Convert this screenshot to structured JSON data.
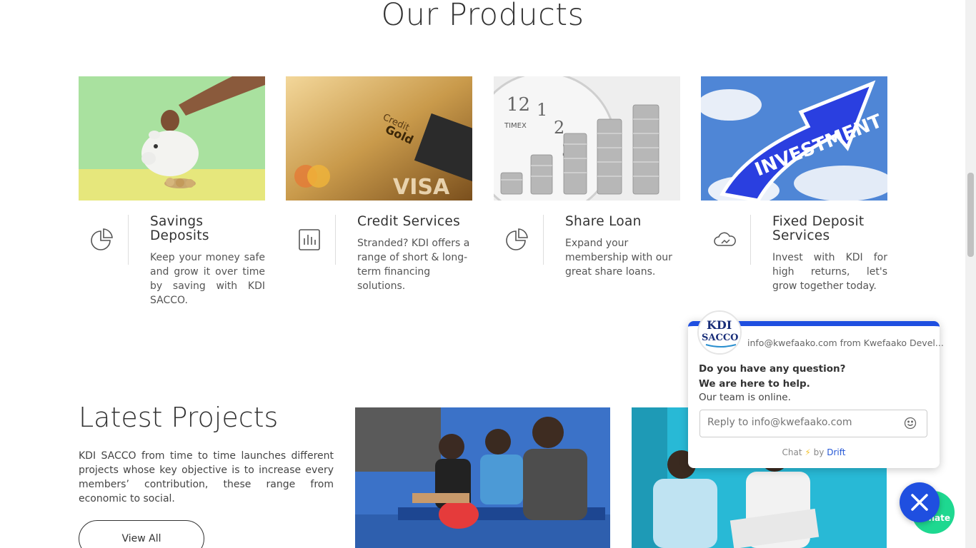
{
  "products": {
    "heading": "Our Products",
    "cards": [
      {
        "title": "Savings Deposits",
        "icon": "pie-chart-icon",
        "description": "Keep your money safe and grow it over time by saving with KDI SACCO."
      },
      {
        "title": "Credit Services",
        "icon": "bar-chart-icon",
        "description": "Stranded? KDI offers a range of short & long-term financing solutions.",
        "image_text": [
          "Credit",
          "Gold",
          "VISA"
        ]
      },
      {
        "title": "Share Loan",
        "icon": "pie-chart-icon",
        "description": "Expand your membership with our great share loans.",
        "image_text": [
          "TIMEX",
          "12",
          "1",
          "2",
          "3"
        ]
      },
      {
        "title": "Fixed Deposit Services",
        "icon": "cloud-icon",
        "description": "Invest with KDI for high returns, let's grow together today.",
        "image_text": [
          "INVESTMENT"
        ]
      }
    ]
  },
  "projects": {
    "heading": "Latest Projects",
    "text": "KDI SACCO from time to time launches different projects whose key objective is to increase every members’ contribution, these range from economic to social.",
    "button_label": "View All"
  },
  "chat": {
    "from": "info@kwefaako.com from Kwefaako Devel...",
    "question_line1": "Do you have any question?",
    "question_line2": "We are here to help.",
    "online": "Our team is online.",
    "reply_placeholder": "Reply to info@kwefaako.com",
    "powered_prefix": "Chat",
    "powered_by": "by",
    "powered_brand": "Drift",
    "logo_text": "SACCO"
  },
  "donate": {
    "label": "nate"
  },
  "colors": {
    "accent": "#1f4fe0",
    "donate": "#1ed890"
  }
}
